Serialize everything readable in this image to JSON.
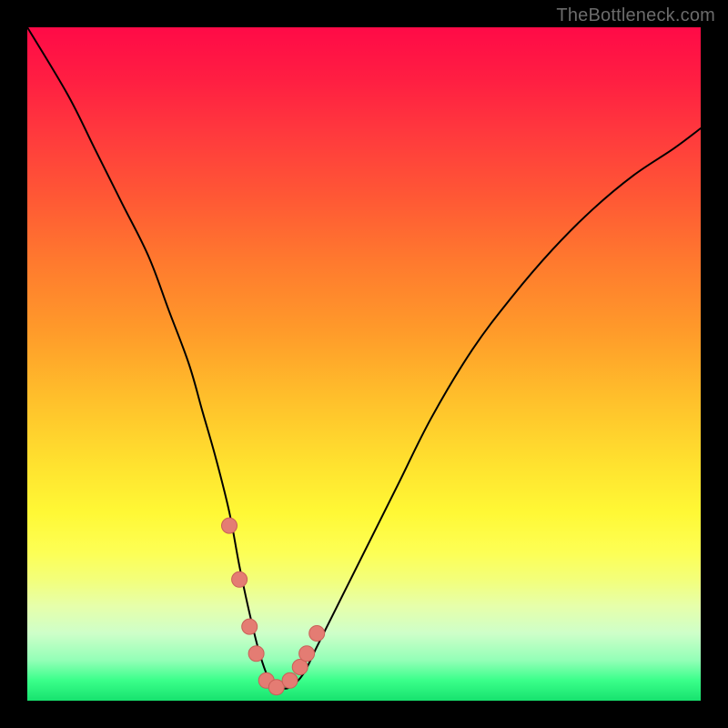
{
  "watermark": "TheBottleneck.com",
  "colors": {
    "background": "#000000",
    "curve": "#000000",
    "marker_fill": "#e47c73",
    "marker_stroke": "#c95f57",
    "gradient_top": "#ff0a47",
    "gradient_bottom": "#17e26e"
  },
  "chart_data": {
    "type": "line",
    "title": "",
    "xlabel": "",
    "ylabel": "",
    "xlim": [
      0,
      100
    ],
    "ylim": [
      0,
      100
    ],
    "grid": false,
    "legend": false,
    "series": [
      {
        "name": "bottleneck-curve",
        "x": [
          0,
          6,
          10,
          14,
          18,
          21,
          24,
          26,
          28,
          30,
          31.5,
          33,
          34.5,
          36,
          37.5,
          39,
          41,
          43,
          46,
          50,
          55,
          60,
          66,
          72,
          78,
          84,
          90,
          96,
          100
        ],
        "values": [
          100,
          90,
          82,
          74,
          66,
          58,
          50,
          43,
          36,
          28,
          20,
          13,
          7,
          3,
          2,
          2,
          4,
          8,
          14,
          22,
          32,
          42,
          52,
          60,
          67,
          73,
          78,
          82,
          85
        ]
      }
    ],
    "markers": {
      "name": "highlight-points",
      "x": [
        30,
        31.5,
        33,
        34,
        35.5,
        37,
        39,
        40.5,
        41.5,
        43
      ],
      "values": [
        26,
        18,
        11,
        7,
        3,
        2,
        3,
        5,
        7,
        10
      ]
    }
  }
}
